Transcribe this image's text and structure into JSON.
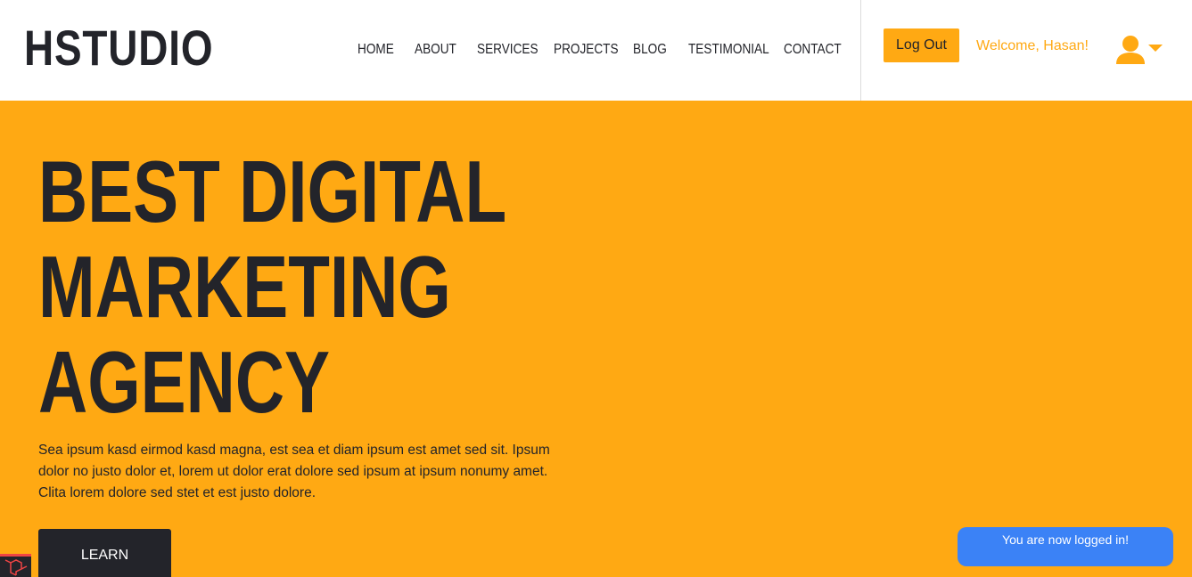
{
  "header": {
    "logo": "HSTUDIO",
    "nav": [
      "HOME",
      "ABOUT",
      "SERVICES",
      "PROJECTS",
      "BLOG",
      "TESTIMONIAL",
      "CONTACT"
    ],
    "logout_label": "Log Out",
    "welcome": "Welcome, Hasan!",
    "user_icon": "user-icon",
    "dropdown_icon": "caret-down-icon"
  },
  "hero": {
    "title_lines": [
      "BEST DIGITAL",
      "MARKETING",
      "AGENCY"
    ],
    "text": "Sea ipsum kasd eirmod kasd magna, est sea et diam ipsum est amet sed sit. Ipsum dolor no justo dolor et, lorem ut dolor erat dolore sed ipsum at ipsum nonumy amet. Clita lorem dolore sed stet et est justo dolore.",
    "button_label": "LEARN"
  },
  "toast": {
    "message": "You are now logged in!"
  },
  "colors": {
    "accent": "#ffa913",
    "dark": "#23242a",
    "toast": "#3b82f6"
  }
}
